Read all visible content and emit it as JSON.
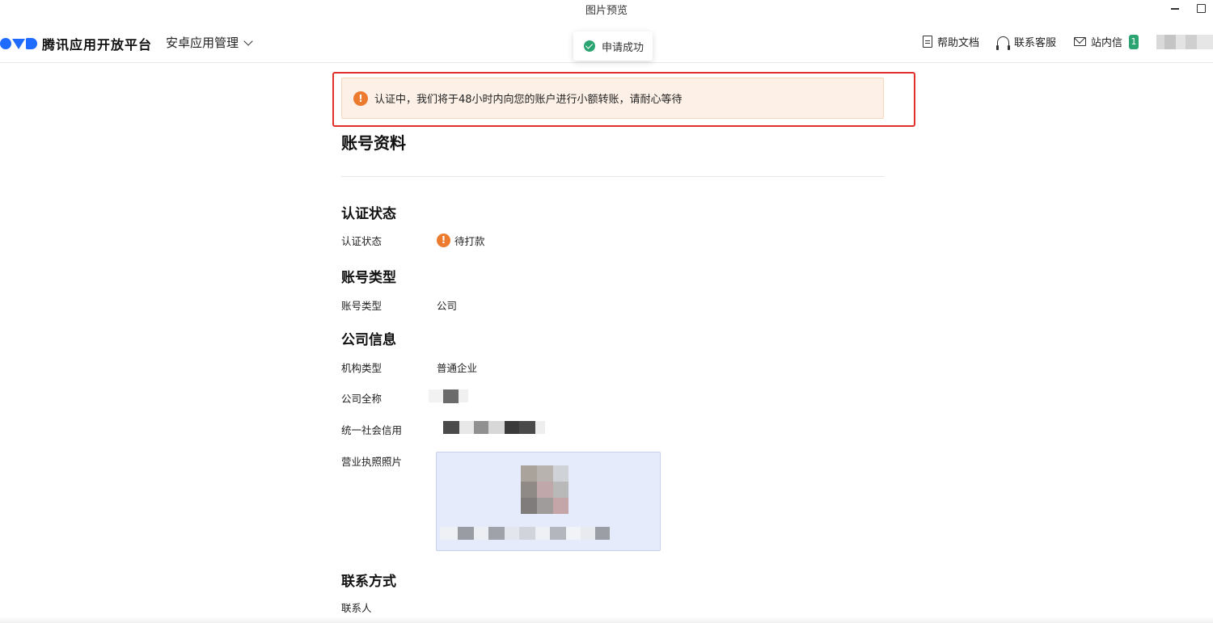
{
  "window": {
    "title": "图片预览"
  },
  "header": {
    "logo_text": "腾讯应用开放平台",
    "nav_menu": "安卓应用管理",
    "help_docs": "帮助文档",
    "contact_support": "联系客服",
    "inbox": "站内信",
    "inbox_count": "1"
  },
  "toast": {
    "message": "申请成功"
  },
  "notice": {
    "icon": "!",
    "text": "认证中，我们将于48小时内向您的账户进行小额转账，请耐心等待"
  },
  "page": {
    "title": "账号资料"
  },
  "sections": {
    "auth": {
      "title": "认证状态",
      "label": "认证状态",
      "status_icon": "!",
      "value": "待打款"
    },
    "account_type": {
      "title": "账号类型",
      "label": "账号类型",
      "value": "公司"
    },
    "company": {
      "title": "公司信息",
      "org_type_label": "机构类型",
      "org_type_value": "普通企业",
      "full_name_label": "公司全称",
      "credit_code_label": "统一社会信用",
      "license_label": "营业执照照片"
    },
    "contact": {
      "title": "联系方式",
      "person_label": "联系人"
    }
  },
  "colors": {
    "accent": "#1f6bff",
    "success": "#2ba471",
    "warning": "#ed7b2f",
    "highlight": "#e0302a"
  },
  "icons": [
    "logo-icon",
    "chevron-down-icon",
    "document-icon",
    "headset-icon",
    "mail-icon",
    "check-circle-icon",
    "warning-icon",
    "minimize-icon",
    "maximize-icon"
  ]
}
